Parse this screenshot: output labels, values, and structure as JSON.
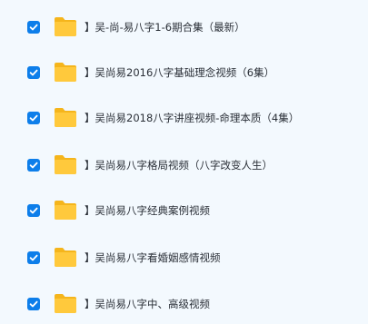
{
  "files": [
    {
      "name": "】吴-尚-易八字1-6期合集（最新）",
      "checked": true
    },
    {
      "name": "】吴尚易2016八字基础理念视频（6集）",
      "checked": true
    },
    {
      "name": "】吴尚易2018八字讲座视频-命理本质（4集）",
      "checked": true
    },
    {
      "name": "】吴尚易八字格局视频（八字改变人生）",
      "checked": true
    },
    {
      "name": "】吴尚易八字经典案例视频",
      "checked": true
    },
    {
      "name": "】吴尚易八字看婚姻感情视频",
      "checked": true
    },
    {
      "name": "】吴尚易八字中、高级视频",
      "checked": true
    }
  ],
  "colors": {
    "background": "#f3f9fe",
    "checkbox": "#0d7eea",
    "folder": "#ffc93c",
    "text": "#2a2f37"
  },
  "icons": {
    "checkbox": "checkmark-icon",
    "folder": "folder-icon"
  }
}
